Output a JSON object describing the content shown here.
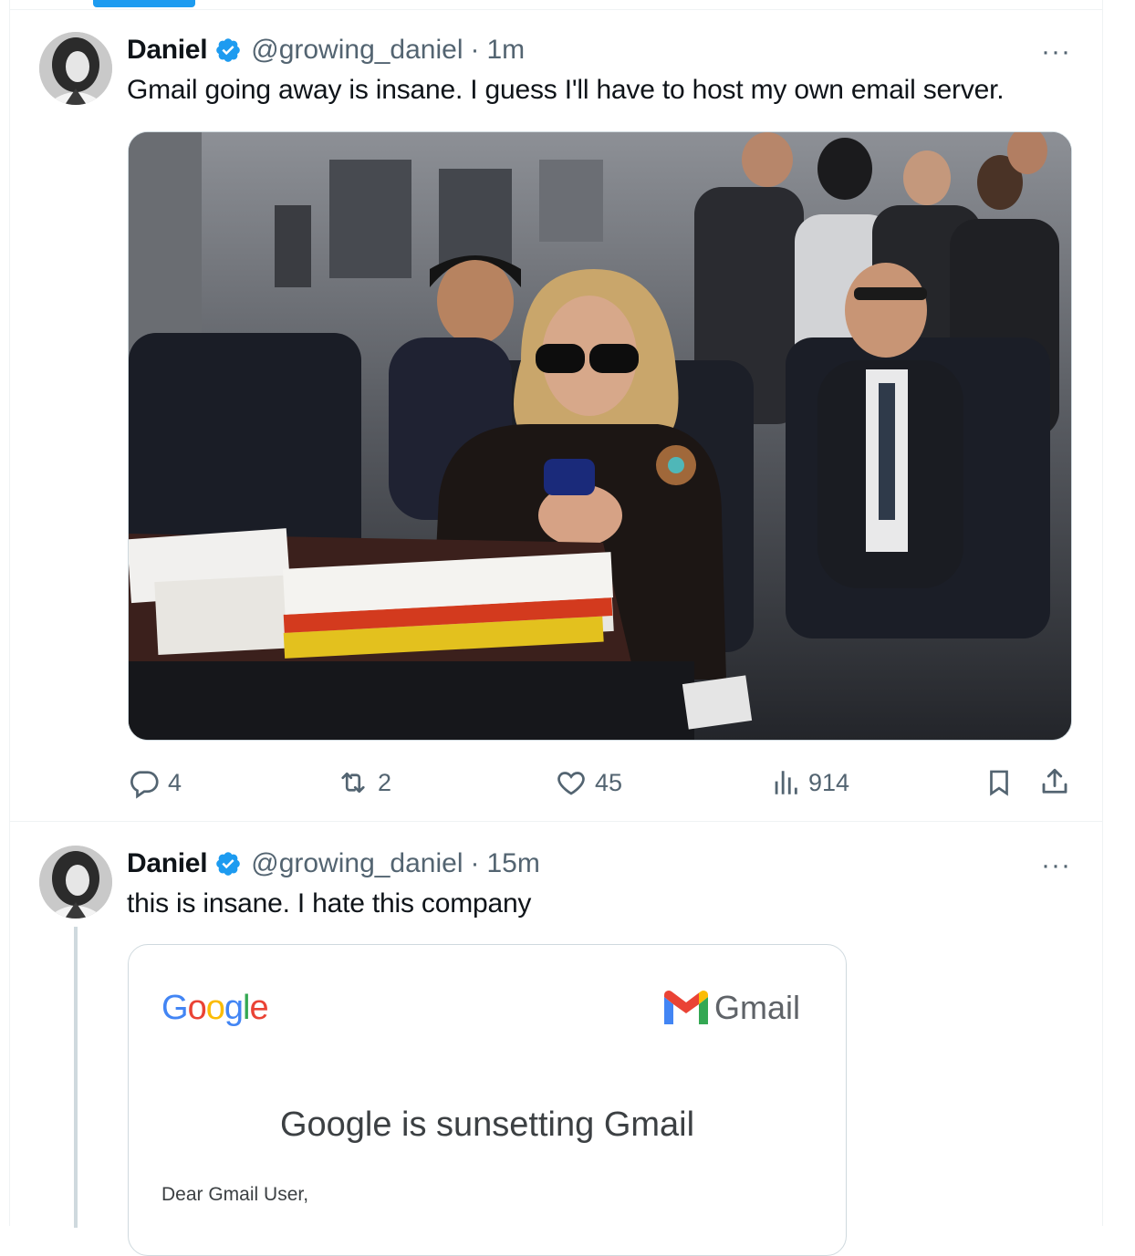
{
  "tweets": [
    {
      "author": "Daniel",
      "handle": "@growing_daniel",
      "separator": "·",
      "time": "1m",
      "more": "···",
      "text": "Gmail going away is insane. I guess I'll have to host my own email server.",
      "actions": {
        "replies": "4",
        "reposts": "2",
        "likes": "45",
        "views": "914"
      }
    },
    {
      "author": "Daniel",
      "handle": "@growing_daniel",
      "separator": "·",
      "time": "15m",
      "more": "···",
      "text": "this is insane. I hate this company",
      "card": {
        "google_logo": "Google",
        "gmail_logo": "Gmail",
        "title": "Google is sunsetting Gmail",
        "greeting": "Dear Gmail User,"
      }
    }
  ],
  "colors": {
    "accent": "#1d9bf0",
    "muted_text": "#536471",
    "border": "#eff3f4"
  },
  "icons": [
    "verified-badge-icon",
    "reply-icon",
    "repost-icon",
    "like-icon",
    "views-icon",
    "bookmark-icon",
    "share-icon",
    "more-icon"
  ]
}
